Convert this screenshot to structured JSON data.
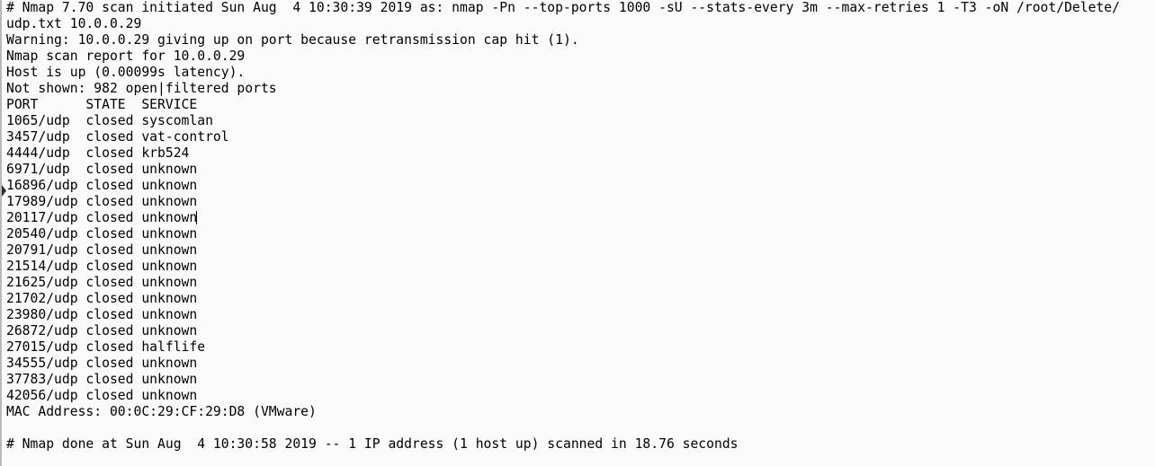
{
  "terminal": {
    "background_color": "#fbfbfb",
    "text_color": "#000000",
    "border_color": "#b9b9b9",
    "caret_color": "#000000",
    "gutter_marker": "scroll-position-marker"
  },
  "scan": {
    "header_line_1": "# Nmap 7.70 scan initiated Sun Aug  4 10:30:39 2019 as: nmap -Pn --top-ports 1000 -sU --stats-every 3m --max-retries 1 -T3 -oN /root/Delete/",
    "header_line_2": "udp.txt 10.0.0.29",
    "warning": "Warning: 10.0.0.29 giving up on port because retransmission cap hit (1).",
    "report_for": "Nmap scan report for 10.0.0.29",
    "host_status": "Host is up (0.00099s latency).",
    "not_shown": "Not shown: 982 open|filtered ports",
    "mac_address": "MAC Address: 00:0C:29:CF:29:D8 (VMware)",
    "footer": "# Nmap done at Sun Aug  4 10:30:58 2019 -- 1 IP address (1 host up) scanned in 18.76 seconds",
    "nmap_version": "7.70",
    "target_ip": "10.0.0.29",
    "start_time": "Sun Aug  4 10:30:39 2019",
    "end_time": "Sun Aug  4 10:30:58 2019",
    "duration_seconds": "18.76",
    "latency_seconds": "0.00099",
    "not_shown_count": "982",
    "output_file": "/root/Delete/udp.txt",
    "command": "nmap -Pn --top-ports 1000 -sU --stats-every 3m --max-retries 1 -T3 -oN /root/Delete/udp.txt 10.0.0.29"
  },
  "table": {
    "headers": [
      "PORT",
      "STATE",
      "SERVICE"
    ],
    "header_line": "PORT      STATE  SERVICE",
    "rows": [
      {
        "line": "1065/udp  closed syscomlan",
        "port": "1065/udp",
        "state": "closed",
        "service": "syscomlan",
        "caret": false
      },
      {
        "line": "3457/udp  closed vat-control",
        "port": "3457/udp",
        "state": "closed",
        "service": "vat-control",
        "caret": false
      },
      {
        "line": "4444/udp  closed krb524",
        "port": "4444/udp",
        "state": "closed",
        "service": "krb524",
        "caret": false
      },
      {
        "line": "6971/udp  closed unknown",
        "port": "6971/udp",
        "state": "closed",
        "service": "unknown",
        "caret": false
      },
      {
        "line": "16896/udp closed unknown",
        "port": "16896/udp",
        "state": "closed",
        "service": "unknown",
        "caret": false
      },
      {
        "line": "17989/udp closed unknown",
        "port": "17989/udp",
        "state": "closed",
        "service": "unknown",
        "caret": false
      },
      {
        "line": "20117/udp closed unknown",
        "port": "20117/udp",
        "state": "closed",
        "service": "unknown",
        "caret": true
      },
      {
        "line": "20540/udp closed unknown",
        "port": "20540/udp",
        "state": "closed",
        "service": "unknown",
        "caret": false
      },
      {
        "line": "20791/udp closed unknown",
        "port": "20791/udp",
        "state": "closed",
        "service": "unknown",
        "caret": false
      },
      {
        "line": "21514/udp closed unknown",
        "port": "21514/udp",
        "state": "closed",
        "service": "unknown",
        "caret": false
      },
      {
        "line": "21625/udp closed unknown",
        "port": "21625/udp",
        "state": "closed",
        "service": "unknown",
        "caret": false
      },
      {
        "line": "21702/udp closed unknown",
        "port": "21702/udp",
        "state": "closed",
        "service": "unknown",
        "caret": false
      },
      {
        "line": "23980/udp closed unknown",
        "port": "23980/udp",
        "state": "closed",
        "service": "unknown",
        "caret": false
      },
      {
        "line": "26872/udp closed unknown",
        "port": "26872/udp",
        "state": "closed",
        "service": "unknown",
        "caret": false
      },
      {
        "line": "27015/udp closed halflife",
        "port": "27015/udp",
        "state": "closed",
        "service": "halflife",
        "caret": false
      },
      {
        "line": "34555/udp closed unknown",
        "port": "34555/udp",
        "state": "closed",
        "service": "unknown",
        "caret": false
      },
      {
        "line": "37783/udp closed unknown",
        "port": "37783/udp",
        "state": "closed",
        "service": "unknown",
        "caret": false
      },
      {
        "line": "42056/udp closed unknown",
        "port": "42056/udp",
        "state": "closed",
        "service": "unknown",
        "caret": false
      }
    ]
  }
}
